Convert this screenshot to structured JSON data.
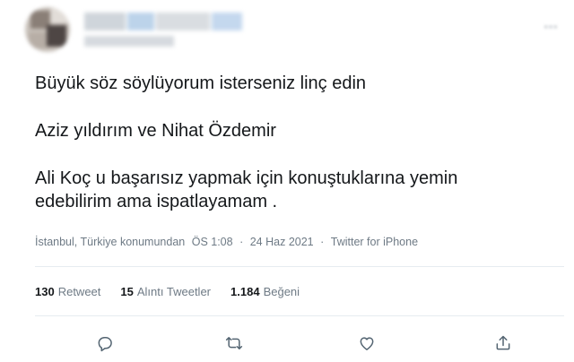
{
  "tweet": {
    "lines": [
      "Büyük söz söylüyorum isterseniz linç edin",
      "Aziz yıldırım ve Nihat Özdemir",
      "Ali Koç u başarısız yapmak için konuştuklarına yemin",
      "edebilirim ama ispatlayamam ."
    ],
    "meta": {
      "location": "İstanbul, Türkiye konumundan",
      "time": "ÖS 1:08",
      "separator": "·",
      "date": "24 Haz 2021",
      "source": "Twitter for iPhone"
    },
    "stats": {
      "retweets": {
        "count": "130",
        "label": "Retweet"
      },
      "quotes": {
        "count": "15",
        "label": "Alıntı Tweetler"
      },
      "likes": {
        "count": "1.184",
        "label": "Beğeni"
      }
    }
  },
  "icons": {
    "reply": "reply-icon",
    "retweet": "retweet-icon",
    "like": "heart-icon",
    "share": "share-icon",
    "more": "more-icon"
  },
  "colors": {
    "text": "#14171a",
    "muted": "#6e7a85",
    "divider": "#e6ecf0"
  }
}
